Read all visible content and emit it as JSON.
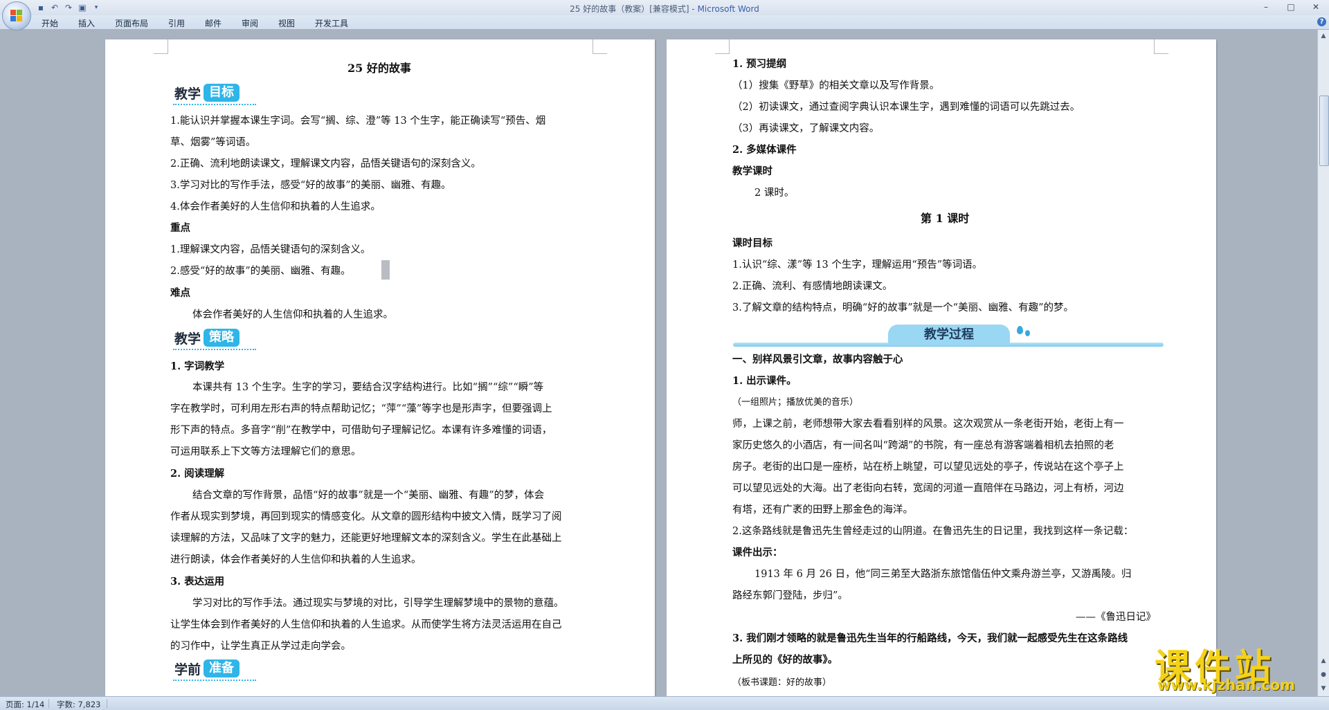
{
  "window": {
    "title": "25 好的故事（教案）[兼容模式]",
    "app": "- Microsoft Word",
    "controls": [
      "–",
      "□",
      "✕"
    ]
  },
  "qat": [
    "save-icon",
    "undo-icon",
    "redo-icon",
    "print-preview-icon",
    "customize-icon"
  ],
  "ribbon_tabs": [
    "开始",
    "插入",
    "页面布局",
    "引用",
    "邮件",
    "审阅",
    "视图",
    "开发工具"
  ],
  "help": "?",
  "left_page": {
    "title": "25  好的故事",
    "badge_goal": [
      "教学",
      "目标"
    ],
    "goal_1a": "1.能认识并掌握本课生字词。会写“搁、综、澄”等 13 个生字，能正确读写“预告、烟",
    "goal_1b": "草、烟雾”等词语。",
    "goal_2": "2.正确、流利地朗读课文，理解课文内容，品悟关键语句的深刻含义。",
    "goal_3": "3.学习对比的写作手法，感受“好的故事”的美丽、幽雅、有趣。",
    "goal_4": "4.体会作者美好的人生信仰和执着的人生追求。",
    "key_head": "重点",
    "key_1": "1.理解课文内容，品悟关键语句的深刻含义。",
    "key_2": "2.感受“好的故事”的美丽、幽雅、有趣。",
    "diff_head": "难点",
    "diff_1": "体会作者美好的人生信仰和执着的人生追求。",
    "badge_strategy": [
      "教学",
      "策略"
    ],
    "s1_head": "1. 字词教学",
    "s1_l1": "本课共有 13 个生字。生字的学习，要结合汉字结构进行。比如“搁”“综”“瞬”等",
    "s1_l2": "字在教学时，可利用左形右声的特点帮助记忆；“萍”“藻”等字也是形声字，但要强调上",
    "s1_l3": "形下声的特点。多音字“削”在教学中，可借助句子理解记忆。本课有许多难懂的词语，",
    "s1_l4": "可运用联系上下文等方法理解它们的意思。",
    "s2_head": "2. 阅读理解",
    "s2_l1": "结合文章的写作背景，品悟“好的故事”就是一个“美丽、幽雅、有趣”的梦，体会",
    "s2_l2": "作者从现实到梦境，再回到现实的情感变化。从文章的圆形结构中披文入情，既学习了阅",
    "s2_l3": "读理解的方法，又品味了文字的魅力，还能更好地理解文本的深刻含义。学生在此基础上",
    "s2_l4": "进行朗读，体会作者美好的人生信仰和执着的人生追求。",
    "s3_head": "3. 表达运用",
    "s3_l1": "学习对比的写作手法。通过现实与梦境的对比，引导学生理解梦境中的景物的意蕴。",
    "s3_l2": "让学生体会到作者美好的人生信仰和执着的人生追求。从而使学生将方法灵活运用在自己",
    "s3_l3": "的习作中，让学生真正从学过走向学会。",
    "badge_prep": [
      "学前",
      "准备"
    ]
  },
  "right_page": {
    "p1_head": "1. 预习提纲",
    "p1_1": "（1）搜集《野草》的相关文章以及写作背景。",
    "p1_2": "（2）初读课文，通过查阅字典认识本课生字，遇到难懂的词语可以先跳过去。",
    "p1_3": "（3）再读课文，了解课文内容。",
    "p2_head": "2. 多媒体课件",
    "hours_head": "教学课时",
    "hours": "2 课时。",
    "lesson_title": "第 1 课时",
    "lg_head": "课时目标",
    "lg_1": "1.认识“综、漾”等 13 个生字，理解运用“预告”等词语。",
    "lg_2": "2.正确、流利、有感情地朗读课文。",
    "lg_3": "3.了解文章的结构特点，明确“好的故事”就是一个“美丽、幽雅、有趣”的梦。",
    "process_banner": "教学过程",
    "sec1_head": "一、别样风景引文章，故事内容触于心",
    "sec1_1_head": "1. 出示课件。",
    "sec1_note": "（一组照片；播放优美的音乐）",
    "t_l1": "师，上课之前，老师想带大家去看看别样的风景。这次观赏从一条老街开始，老街上有一",
    "t_l2": "家历史悠久的小酒店，有一间名叫“跨湖”的书院，有一座总有游客端着相机去拍照的老",
    "t_l3": "房子。老街的出口是一座桥，站在桥上眺望，可以望见远处的亭子，传说站在这个亭子上",
    "t_l4": "可以望见远处的大海。出了老街向右转，宽阔的河道一直陪伴在马路边，河上有桥，河边",
    "t_l5": "有塔，还有广袤的田野上那金色的海洋。",
    "sec1_2": "2.这条路线就是鲁迅先生曾经走过的山阴道。在鲁迅先生的日记里，我找到这样一条记载：",
    "courseware": "课件出示：",
    "quote_l1": "1913 年 6 月 26 日，他“同三弟至大路浙东旅馆偕伍仲文乘舟游兰亭，又游禹陵。归",
    "quote_l2": "路经东郭门登陆，步归”。",
    "quote_src": "——《鲁迅日记》",
    "sec1_3_l1": "3. 我们刚才领略的就是鲁迅先生当年的行船路线，今天，我们就一起感受先生在这条路线",
    "sec1_3_l2": "上所见的《好的故事》。",
    "board_note": "（板书课题：好的故事）"
  },
  "status": {
    "page": "页面: 1/14",
    "words": "字数: 7,823"
  },
  "watermark": {
    "cn": "课件站",
    "url": "www.kjzhan.com"
  },
  "colors": {
    "badge_blue": "#2fb5e8",
    "ribbon_bg": "#d7e1ee",
    "workspace_bg": "#a9b3c0",
    "watermark_yellow": "#f4d21a"
  }
}
